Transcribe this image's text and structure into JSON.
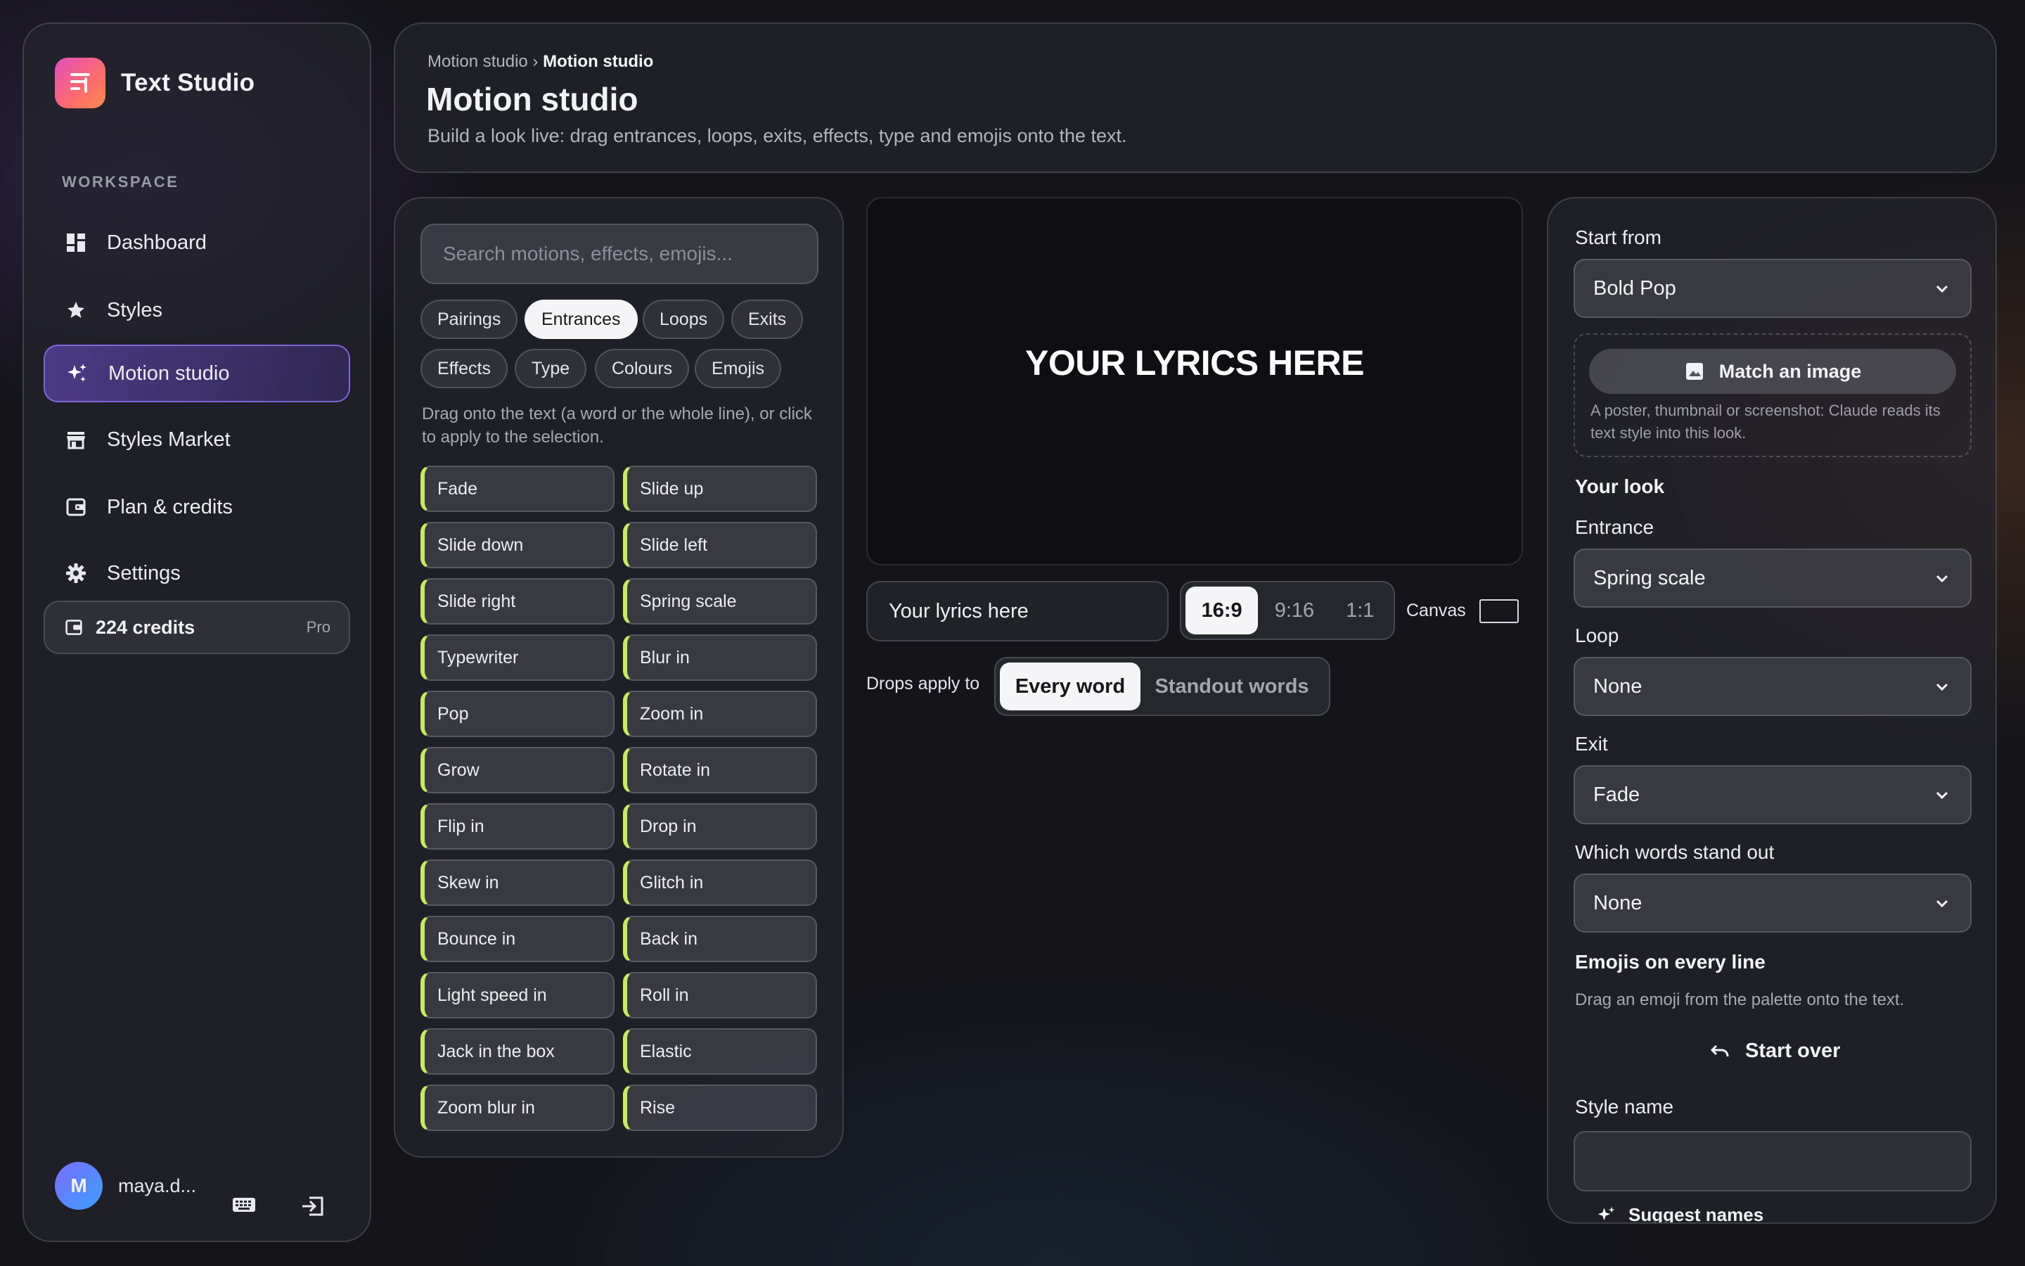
{
  "app": {
    "name": "Text Studio"
  },
  "sidebar": {
    "section_label": "WORKSPACE",
    "items": [
      {
        "label": "Dashboard",
        "icon": "dashboard-icon"
      },
      {
        "label": "Styles",
        "icon": "star-icon"
      },
      {
        "label": "Motion studio",
        "icon": "sparkle-icon",
        "active": true
      },
      {
        "label": "Styles Market",
        "icon": "store-icon"
      },
      {
        "label": "Plan & credits",
        "icon": "wallet-icon"
      },
      {
        "label": "Settings",
        "icon": "gear-icon"
      }
    ],
    "credits": {
      "label": "224 credits",
      "tier": "Pro"
    },
    "user": {
      "initial": "M",
      "name": "maya.d..."
    }
  },
  "header": {
    "breadcrumb_parent": "Motion studio",
    "breadcrumb_separator": "›",
    "breadcrumb_current": "Motion studio",
    "title": "Motion studio",
    "subtitle": "Build a look live: drag entrances, loops, exits, effects, type and emojis onto the text."
  },
  "palette": {
    "search_placeholder": "Search motions, effects, emojis...",
    "tabs": [
      {
        "label": "Pairings"
      },
      {
        "label": "Entrances",
        "active": true
      },
      {
        "label": "Loops"
      },
      {
        "label": "Exits"
      },
      {
        "label": "Effects"
      },
      {
        "label": "Type"
      },
      {
        "label": "Colours"
      },
      {
        "label": "Emojis"
      }
    ],
    "hint": "Drag onto the text (a word or the whole line), or click to apply to the selection.",
    "motions": [
      "Fade",
      "Slide up",
      "Slide down",
      "Slide left",
      "Slide right",
      "Spring scale",
      "Typewriter",
      "Blur in",
      "Pop",
      "Zoom in",
      "Grow",
      "Rotate in",
      "Flip in",
      "Drop in",
      "Skew in",
      "Glitch in",
      "Bounce in",
      "Back in",
      "Light speed in",
      "Roll in",
      "Jack in the box",
      "Elastic",
      "Zoom blur in",
      "Rise"
    ],
    "accent_color": "#c6ec5a"
  },
  "preview": {
    "text": "YOUR LYRICS HERE",
    "lyrics_value": "Your lyrics here",
    "ratios": [
      {
        "label": "16:9",
        "active": true
      },
      {
        "label": "9:16"
      },
      {
        "label": "1:1"
      }
    ],
    "canvas_label": "Canvas",
    "drops_label": "Drops apply to",
    "drops_options": [
      {
        "label": "Every word",
        "active": true
      },
      {
        "label": "Standout words"
      }
    ]
  },
  "look": {
    "start_from_label": "Start from",
    "start_from_value": "Bold Pop",
    "match_button": "Match an image",
    "match_note": "A poster, thumbnail or screenshot: Claude reads its text style into this look.",
    "your_look_heading": "Your look",
    "entrance_label": "Entrance",
    "entrance_value": "Spring scale",
    "loop_label": "Loop",
    "loop_value": "None",
    "exit_label": "Exit",
    "exit_value": "Fade",
    "standout_label": "Which words stand out",
    "standout_value": "None",
    "emojis_heading": "Emojis on every line",
    "emojis_note": "Drag an emoji from the palette onto the text.",
    "start_over": "Start over",
    "style_name_label": "Style name",
    "style_name_value": "",
    "suggest_names": "Suggest names"
  }
}
